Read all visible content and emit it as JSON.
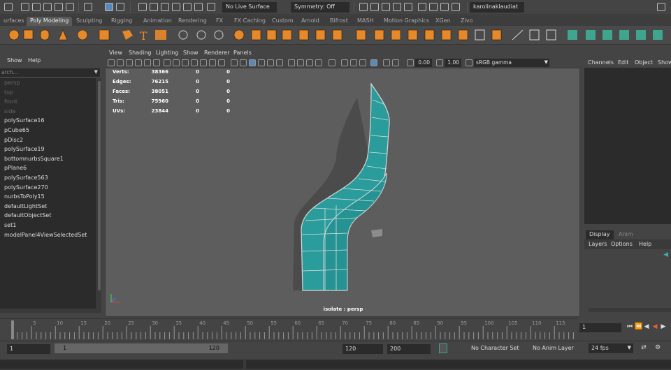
{
  "statusbar": {
    "live_surface": "No Live Surface",
    "symmetry": "Symmetry: Off",
    "username": "karolinaklaudiat"
  },
  "shelf_tabs": [
    "urfaces",
    "Poly Modeling",
    "Sculpting",
    "Rigging",
    "Animation",
    "Rendering",
    "FX",
    "FX Caching",
    "Custom",
    "Arnold",
    "Bifrost",
    "MASH",
    "Motion Graphics",
    "XGen",
    "Zivo"
  ],
  "shelf_active_index": 1,
  "outliner": {
    "menu": [
      "Show",
      "Help"
    ],
    "search_placeholder": "arch...",
    "items": [
      {
        "label": "persp",
        "dim": true
      },
      {
        "label": "top",
        "dim": true
      },
      {
        "label": "front",
        "dim": true
      },
      {
        "label": "side",
        "dim": true
      },
      {
        "label": "polySurface16",
        "dim": false
      },
      {
        "label": "pCube65",
        "dim": false
      },
      {
        "label": "pDisc2",
        "dim": false
      },
      {
        "label": "polySurface19",
        "dim": false
      },
      {
        "label": "bottomnurbsSquare1",
        "dim": false
      },
      {
        "label": "pPlane6",
        "dim": false
      },
      {
        "label": "polySurface563",
        "dim": false
      },
      {
        "label": "polySurface270",
        "dim": false
      },
      {
        "label": "nurbsToPoly15",
        "dim": false
      },
      {
        "label": "defaultLightSet",
        "dim": false
      },
      {
        "label": "defaultObjectSet",
        "dim": false
      },
      {
        "label": "set1",
        "dim": false
      },
      {
        "label": "modelPanel4ViewSelectedSet",
        "dim": false
      }
    ]
  },
  "viewport": {
    "menu": [
      "View",
      "Shading",
      "Lighting",
      "Show",
      "Renderer",
      "Panels"
    ],
    "exposure": "0.00",
    "gamma": "1.00",
    "color_space": "sRGB gamma",
    "hud": [
      {
        "label": "Verts:",
        "value": "38366",
        "sel": "0",
        "comp": "0"
      },
      {
        "label": "Edges:",
        "value": "76215",
        "sel": "0",
        "comp": "0"
      },
      {
        "label": "Faces:",
        "value": "38051",
        "sel": "0",
        "comp": "0"
      },
      {
        "label": "Tris:",
        "value": "75960",
        "sel": "0",
        "comp": "0"
      },
      {
        "label": "UVs:",
        "value": "23844",
        "sel": "0",
        "comp": "0"
      }
    ],
    "camera_label": "isolate : persp",
    "mesh_color": "#2a9c9c"
  },
  "channel_box": {
    "menu": [
      "Channels",
      "Edit",
      "Object",
      "Show"
    ]
  },
  "layer_editor": {
    "tabs": [
      "Display",
      "Anim"
    ],
    "menu": [
      "Layers",
      "Options",
      "Help"
    ]
  },
  "timeslider": {
    "ticks": [
      "5",
      "10",
      "15",
      "20",
      "25",
      "30",
      "35",
      "40",
      "45",
      "50",
      "55",
      "60",
      "65",
      "70",
      "75",
      "80",
      "85",
      "90",
      "95",
      "100",
      "105",
      "110",
      "115"
    ],
    "current_frame": "1"
  },
  "rangebar": {
    "start_field": "1",
    "range_start": "1",
    "range_end": "120",
    "end_field": "120",
    "anim_end": "200",
    "character_set": "No Character Set",
    "anim_layer": "No Anim Layer",
    "fps": "24 fps"
  }
}
